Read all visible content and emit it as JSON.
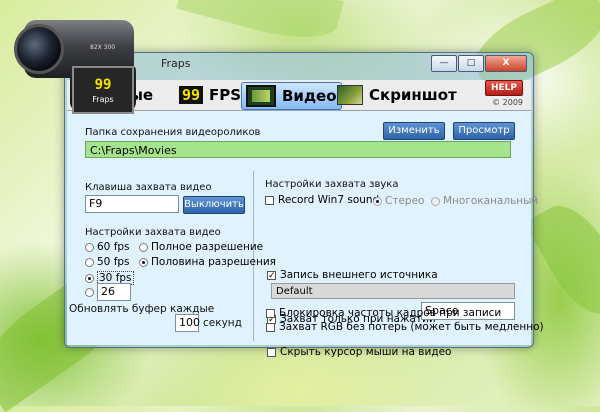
{
  "title": "Fraps",
  "window": {
    "minimize": "—",
    "maximize": "□",
    "close": "X"
  },
  "camera": {
    "badge": "99",
    "label": "Fraps",
    "spec": "82X 300"
  },
  "tabs": [
    {
      "label": "ные",
      "icon": "general-tab-icon"
    },
    {
      "label": "FPS",
      "icon": "fps-icon",
      "icon_text": "99"
    },
    {
      "label": "Видео",
      "icon": "film-icon",
      "active": true
    },
    {
      "label": "Скриншот",
      "icon": "screenshot-icon"
    }
  ],
  "help": {
    "label": "HELP",
    "copyright": "© 2009"
  },
  "folder": {
    "label": "Папка сохранения видеороликов",
    "path": "C:\\Fraps\\Movies",
    "change_button": "Изменить",
    "view_button": "Просмотр"
  },
  "hotkey": {
    "label": "Клавиша захвата видео",
    "value": "F9",
    "disable_button": "Выключить"
  },
  "video_settings": {
    "label": "Настройки захвата видео",
    "fps_options": [
      "60 fps",
      "50 fps",
      "30 fps"
    ],
    "fps_selected": "30 fps",
    "custom_fps": "26",
    "resolution_options": [
      "Полное разрешение",
      "Половина разрешения"
    ],
    "resolution_selected": "Половина разрешения"
  },
  "buffer": {
    "label": "Обновлять буфер каждые",
    "value": "100",
    "unit": "секунд"
  },
  "sound": {
    "label": "Настройки захвата звука",
    "win7_label": "Record Win7 sound",
    "win7_checked": false,
    "stereo": "Стерео",
    "multichannel": "Многоканальный",
    "external_label": "Запись внешнего источника",
    "external_checked": true,
    "device": "Default",
    "push_label": "Захват только при нажатии",
    "push_checked": true,
    "push_key": "Space"
  },
  "options": [
    {
      "label": "Скрыть курсор мыши на видео",
      "checked": false
    },
    {
      "label": "Блокировка частоты кадров при записи",
      "checked": false
    },
    {
      "label": "Захват RGB без потерь (может быть медленно)",
      "checked": false
    }
  ],
  "colors": {
    "accent": "#2f64a8",
    "path_bg": "#a4e48c",
    "help": "#c9302c",
    "panel": "#e1f2ff"
  }
}
